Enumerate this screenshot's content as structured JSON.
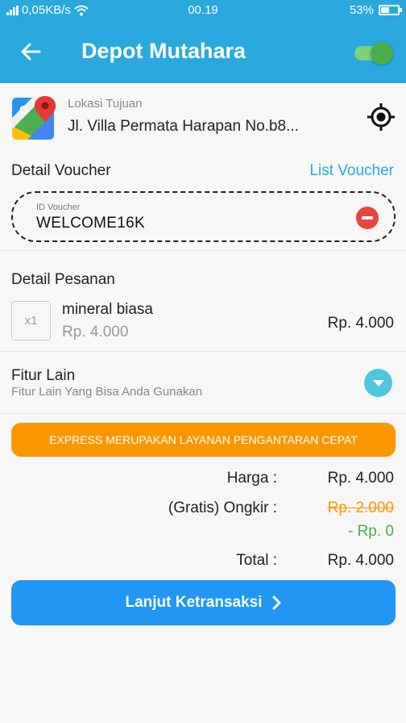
{
  "status_bar": {
    "network_speed": "0,05KB/s",
    "time": "00.19",
    "battery": "53%"
  },
  "app_bar": {
    "title": "Depot Mutahara",
    "toggle_on": true
  },
  "location": {
    "label": "Lokasi Tujuan",
    "value": "Jl. Villa Permata Harapan No.b8..."
  },
  "voucher": {
    "section_title": "Detail Voucher",
    "list_link": "List Voucher",
    "field_label": "ID Voucher",
    "field_value": "WELCOME16K"
  },
  "order": {
    "section_title": "Detail Pesanan",
    "item": {
      "qty": "x1",
      "name": "mineral biasa",
      "unit_price": "Rp. 4.000",
      "total": "Rp. 4.000"
    }
  },
  "features": {
    "title": "Fitur Lain",
    "subtitle": "Fitur Lain Yang Bisa Anda Gunakan"
  },
  "express_banner": "EXPRESS MERUPAKAN LAYANAN PENGANTARAN CEPAT",
  "summary": {
    "price_label": "Harga :",
    "price_value": "Rp. 4.000",
    "shipping_label": "(Gratis) Ongkir :",
    "shipping_original": "Rp. 2.000",
    "shipping_discount": "- Rp. 0",
    "total_label": "Total :",
    "total_value": "Rp. 4.000"
  },
  "cta_label": "Lanjut Ketransaksi",
  "colors": {
    "primary": "#2aa9df",
    "button": "#2196f3",
    "orange": "#fb9600",
    "green": "#4cae4b",
    "red": "#e8453c"
  }
}
